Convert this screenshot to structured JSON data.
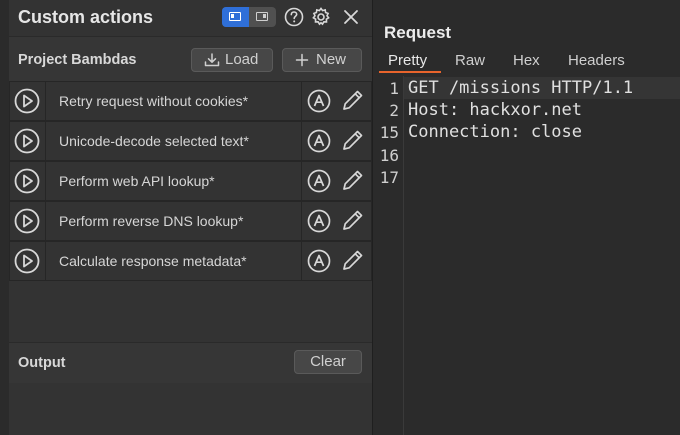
{
  "panel": {
    "title": "Custom actions"
  },
  "bambdas": {
    "section_title": "Project Bambdas",
    "load_label": "Load",
    "new_label": "New",
    "items": [
      {
        "label": "Retry request without cookies*"
      },
      {
        "label": "Unicode-decode selected text*"
      },
      {
        "label": "Perform web API lookup*"
      },
      {
        "label": "Perform reverse DNS lookup*"
      },
      {
        "label": "Calculate response metadata*"
      }
    ]
  },
  "output": {
    "title": "Output",
    "clear_label": "Clear"
  },
  "request": {
    "title": "Request",
    "tabs": [
      {
        "label": "Pretty"
      },
      {
        "label": "Raw"
      },
      {
        "label": "Hex"
      },
      {
        "label": "Headers"
      }
    ],
    "active_tab": "Pretty",
    "lines": [
      {
        "number": "1",
        "text": "GET /missions HTTP/1.1"
      },
      {
        "number": "2",
        "text": "Host: hackxor.net"
      },
      {
        "number": "15",
        "text": "Connection: close"
      },
      {
        "number": "16",
        "text": ""
      },
      {
        "number": "17",
        "text": ""
      }
    ]
  },
  "colors": {
    "accent": "#2f6fd8",
    "tab_underline": "#e8642c"
  },
  "icons": [
    "layout-toggle-icon",
    "help-icon",
    "gear-icon",
    "close-icon",
    "download-icon",
    "plus-icon",
    "play-icon",
    "auto-run-icon",
    "pencil-icon"
  ]
}
